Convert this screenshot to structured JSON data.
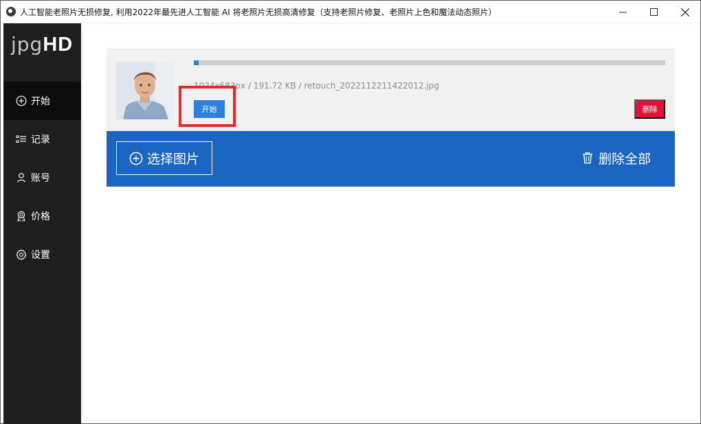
{
  "window": {
    "title": "人工智能老照片无损修复, 利用2022年最先进人工智能 AI 将老照片无损高清修复（支持老照片修复、老照片上色和魔法动态照片）"
  },
  "logo": {
    "light": "jpg",
    "bold": "HD"
  },
  "sidebar": {
    "items": [
      {
        "label": "开始",
        "icon": "plus-circle-icon"
      },
      {
        "label": "记录",
        "icon": "list-icon"
      },
      {
        "label": "账号",
        "icon": "user-icon"
      },
      {
        "label": "价格",
        "icon": "award-icon"
      },
      {
        "label": "设置",
        "icon": "gear-icon"
      }
    ]
  },
  "file": {
    "info": "1024x683px / 191.72 KB / retouch_2022112211422012.jpg",
    "progress": 0.01,
    "start_label": "开始",
    "delete_label": "删除"
  },
  "actions": {
    "select_label": "选择图片",
    "delete_all_label": "删除全部"
  },
  "colors": {
    "sidebar_bg": "#1e1e1e",
    "accent_blue": "#1a66c2",
    "button_blue": "#2f7fe0",
    "delete_red": "#e8103a",
    "highlight_red": "#e52a2a"
  }
}
